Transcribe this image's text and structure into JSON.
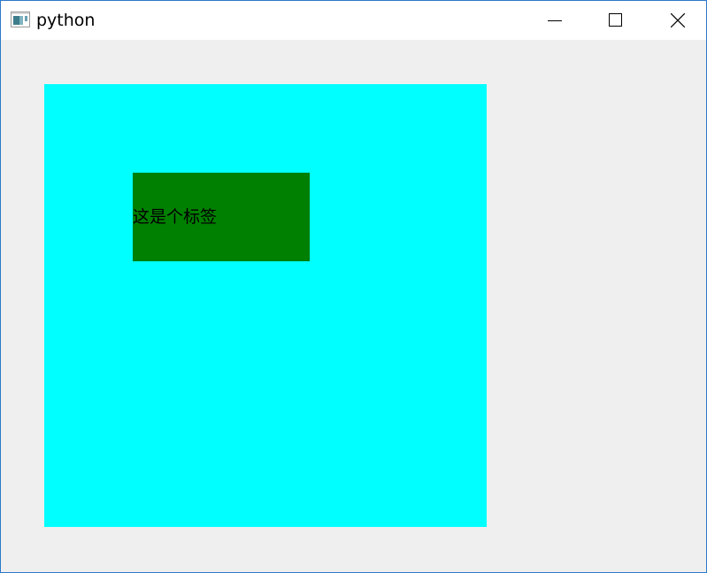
{
  "window": {
    "title": "python",
    "app_icon": "window-app-icon",
    "controls": {
      "minimize_icon": "minimize-icon",
      "maximize_icon": "maximize-icon",
      "close_icon": "close-icon"
    }
  },
  "content": {
    "label_text": "这是个标签"
  },
  "colors": {
    "titlebar_background": "#ffffff",
    "client_background": "#efefef",
    "window_border": "#2b79c9",
    "outer_panel_background": "#00ffff",
    "label_background": "#008000",
    "text": "#000000"
  }
}
